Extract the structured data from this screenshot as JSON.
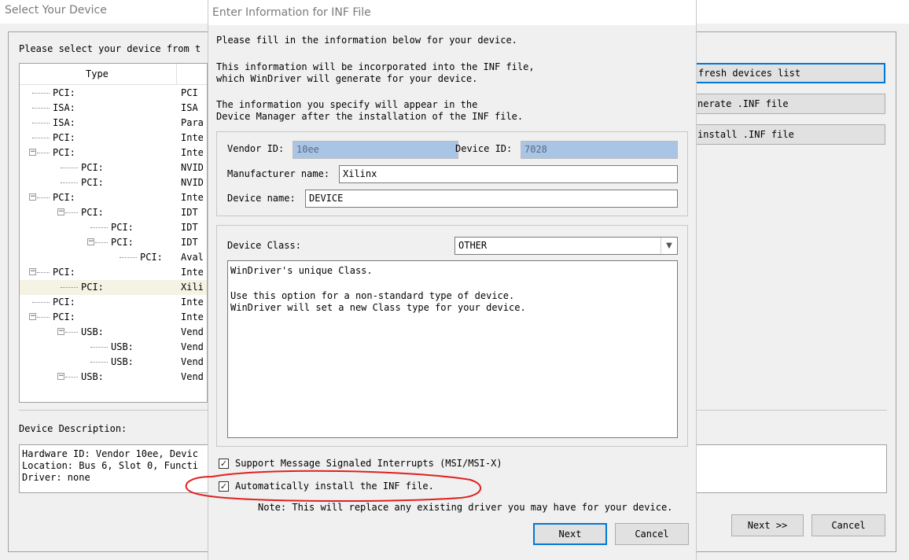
{
  "background_window": {
    "title": "Select Your Device",
    "instruction": "Please select your device from t",
    "column_type": "Type",
    "tree_rows": [
      {
        "label": "PCI:",
        "desc": "PCI",
        "level": 0,
        "toggle": ""
      },
      {
        "label": "ISA:",
        "desc": "ISA",
        "level": 0,
        "toggle": ""
      },
      {
        "label": "ISA:",
        "desc": "Para",
        "level": 0,
        "toggle": ""
      },
      {
        "label": "PCI:",
        "desc": "Inte",
        "level": 0,
        "toggle": ""
      },
      {
        "label": "PCI:",
        "desc": "Inte",
        "level": 0,
        "toggle": "minus"
      },
      {
        "label": "PCI:",
        "desc": "NVID",
        "level": 1,
        "toggle": ""
      },
      {
        "label": "PCI:",
        "desc": "NVID",
        "level": 1,
        "toggle": ""
      },
      {
        "label": "PCI:",
        "desc": "Inte",
        "level": 0,
        "toggle": "minus"
      },
      {
        "label": "PCI:",
        "desc": "IDT",
        "level": 1,
        "toggle": "minus"
      },
      {
        "label": "PCI:",
        "desc": "IDT",
        "level": 2,
        "toggle": ""
      },
      {
        "label": "PCI:",
        "desc": "IDT",
        "level": 2,
        "toggle": "minus"
      },
      {
        "label": "PCI:",
        "desc": "Aval",
        "level": 3,
        "toggle": ""
      },
      {
        "label": "PCI:",
        "desc": "Inte",
        "level": 0,
        "toggle": "minus"
      },
      {
        "label": "PCI:",
        "desc": "Xili",
        "level": 1,
        "toggle": "",
        "selected": true
      },
      {
        "label": "PCI:",
        "desc": "Inte",
        "level": 0,
        "toggle": ""
      },
      {
        "label": "PCI:",
        "desc": "Inte",
        "level": 0,
        "toggle": "minus"
      },
      {
        "label": "USB:",
        "desc": "Vend",
        "level": 1,
        "toggle": "minus"
      },
      {
        "label": "USB:",
        "desc": "Vend",
        "level": 2,
        "toggle": ""
      },
      {
        "label": "USB:",
        "desc": "Vend",
        "level": 2,
        "toggle": ""
      },
      {
        "label": "USB:",
        "desc": "Vend",
        "level": 1,
        "toggle": "minus"
      }
    ],
    "buttons": {
      "refresh": "fresh devices list",
      "generate": "nerate .INF file",
      "uninstall": "install .INF file"
    },
    "device_description_label": "Device Description:",
    "device_description_lines": [
      "Hardware ID:  Vendor 10ee, Devic",
      "Location:  Bus 6, Slot 0, Functi",
      "Driver:  none"
    ],
    "next_label": "Next >>",
    "cancel_label": "Cancel"
  },
  "dialog": {
    "title": "Enter Information for INF File",
    "intro": "Please fill in the information below for your device.",
    "info_line1": "This information will be incorporated into the INF file,",
    "info_line2": "which WinDriver will generate for your device.",
    "dm_line1": "The information you specify will appear in the",
    "dm_line2": "Device Manager after the installation of the INF file.",
    "vendor_id_label": "Vendor ID:",
    "vendor_id_value": "10ee",
    "device_id_label": "Device ID:",
    "device_id_value": "7028",
    "manufacturer_label": "Manufacturer name:",
    "manufacturer_value": "Xilinx",
    "device_name_label": "Device name:",
    "device_name_value": "DEVICE",
    "device_class_label": "Device Class:",
    "device_class_value": "OTHER",
    "class_desc_line1": "WinDriver's unique Class.",
    "class_desc_line2": "Use this option for a non-standard type of device.",
    "class_desc_line3": "WinDriver will set a new Class type for your device.",
    "msi_label": "Support Message Signaled Interrupts (MSI/MSI-X)",
    "auto_install_label": "Automatically install the INF file.",
    "note": "Note: This will replace any existing driver you may have for your device.",
    "next_label": "Next",
    "cancel_label": "Cancel"
  },
  "annotation": {
    "color": "#e02020"
  },
  "colors": {
    "focus_border": "#0078d7",
    "readonly_fill": "#a9c5e6"
  }
}
